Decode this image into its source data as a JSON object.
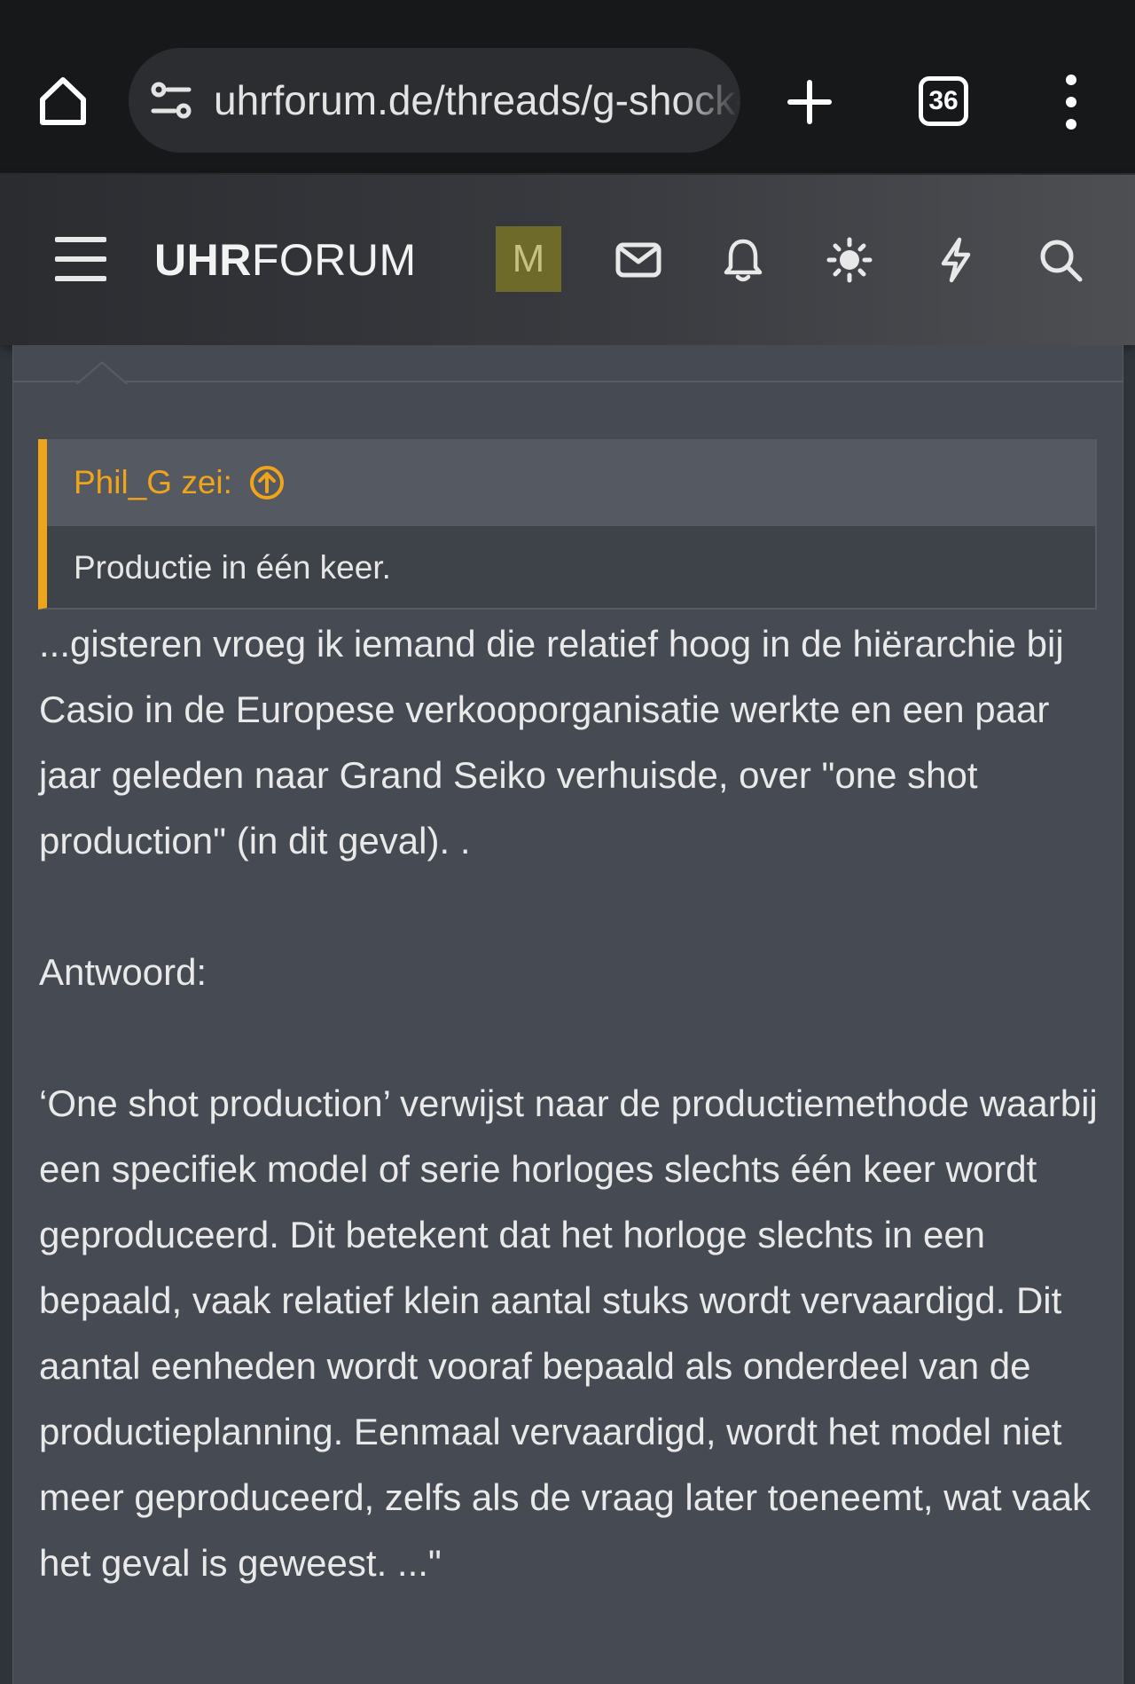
{
  "browser": {
    "url": "uhrforum.de/threads/g-shock-one-shot-production",
    "tab_count": "36"
  },
  "header": {
    "logo_bold": "UHR",
    "logo_light": "FORUM",
    "avatar_letter": "M"
  },
  "quote": {
    "author": "Phil_G zei:",
    "text": "Productie in één keer."
  },
  "post": {
    "paragraph_1": "...gisteren vroeg ik iemand die relatief hoog in de hiërarchie bij Casio in de Europese verkooporganisatie werkte en een paar jaar geleden naar Grand Seiko verhuisde, over \"one shot production\" (in dit geval). .",
    "paragraph_2": "Antwoord:",
    "paragraph_3": "‘One shot production’ verwijst naar de productiemethode waarbij een specifiek model of serie horloges slechts één keer wordt geproduceerd. Dit betekent dat het horloge slechts in een bepaald, vaak relatief klein aantal stuks wordt vervaardigd. Dit aantal eenheden wordt vooraf bepaald als onderdeel van de productieplanning. Eenmaal vervaardigd, wordt het model niet meer geproduceerd, zelfs als de vraag later toeneemt, wat vaak het geval is geweest. ...\""
  },
  "colors": {
    "accent": "#f0a41a",
    "panel": "#464b53",
    "avatar_bg": "#6e6a2a"
  },
  "icons": [
    "home-icon",
    "site-info-icon",
    "plus-icon",
    "tab-switcher-icon",
    "more-vert-icon",
    "hamburger-icon",
    "mail-icon",
    "bell-icon",
    "theme-sun-icon",
    "bolt-icon",
    "search-icon",
    "arrow-up-circle-icon"
  ]
}
